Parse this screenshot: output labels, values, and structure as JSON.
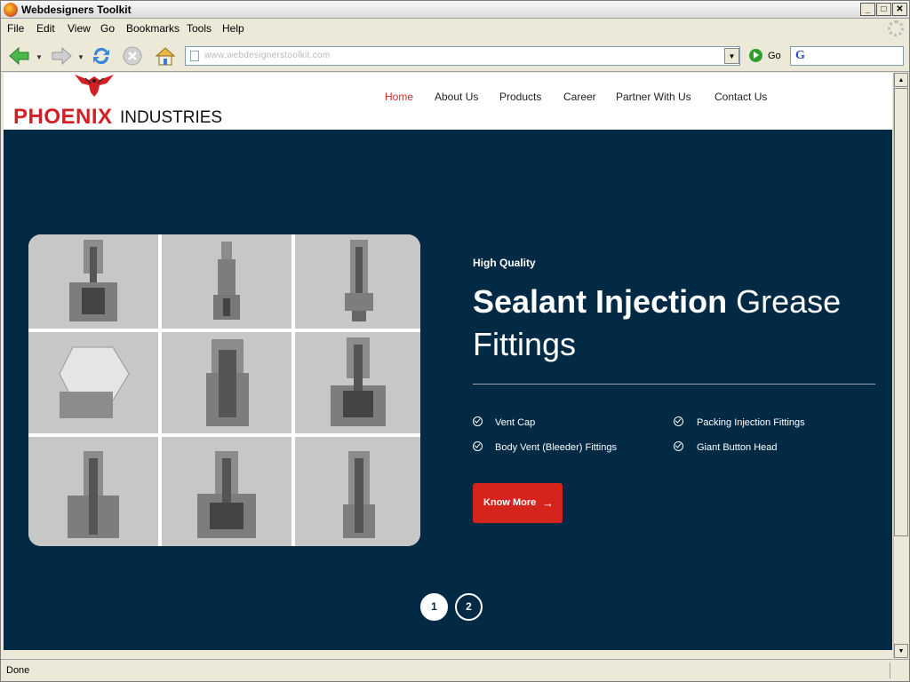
{
  "window": {
    "title": "Webdesigners Toolkit",
    "minimize": "_",
    "maximize": "□",
    "close": "✕"
  },
  "menu": [
    "File",
    "Edit",
    "View",
    "Go",
    "Bookmarks",
    "Tools",
    "Help"
  ],
  "toolbar": {
    "url": "www.webdesignerstoolkit.com",
    "go_label": "Go",
    "search_logo": "G",
    "icons": [
      "back-icon",
      "forward-icon",
      "reload-icon",
      "stop-icon",
      "home-icon"
    ]
  },
  "site": {
    "logo_word1": "PHOENIX",
    "logo_word2": "INDUSTRIES",
    "nav": [
      "Home",
      "About Us",
      "Products",
      "Career",
      "Partner With Us",
      "Contact Us"
    ],
    "active_nav": "Home"
  },
  "hero": {
    "eyebrow": "High Quality",
    "headline_bold": "Sealant Injection",
    "headline_rest1": " Grease",
    "headline_rest2": "Fittings",
    "features": [
      "Vent Cap",
      "Packing Injection Fittings",
      "Body Vent (Bleeder) Fittings",
      "Giant Button Head"
    ],
    "cta": "Know More",
    "cta_arrow": "→",
    "slides": [
      "1",
      "2"
    ],
    "active_slide": "1"
  },
  "status": {
    "text": "Done"
  },
  "colors": {
    "hero_bg": "#022a45",
    "accent_red": "#d4241c",
    "nav_active": "#d02a2a"
  }
}
